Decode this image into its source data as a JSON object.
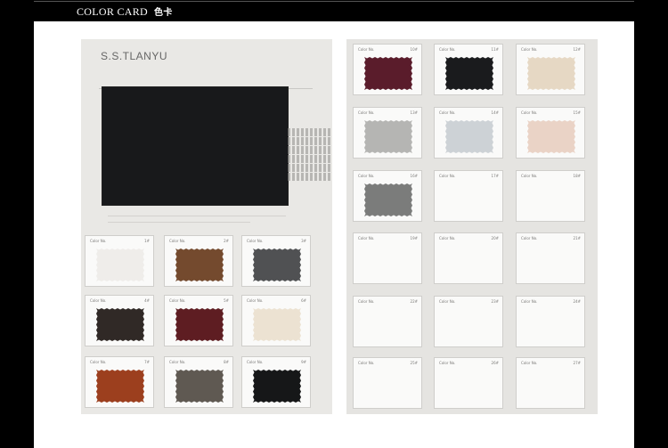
{
  "header": {
    "title_en": "COLOR CARD",
    "title_cn": "色卡"
  },
  "left_page": {
    "brand": "S.S.TLANYU",
    "cards": [
      {
        "label": "Color No.",
        "num": "1#",
        "color": "#efedea"
      },
      {
        "label": "Color No.",
        "num": "2#",
        "color": "#744a2e"
      },
      {
        "label": "Color No.",
        "num": "3#",
        "color": "#505153"
      },
      {
        "label": "Color No.",
        "num": "4#",
        "color": "#302926"
      },
      {
        "label": "Color No.",
        "num": "5#",
        "color": "#5e1d22"
      },
      {
        "label": "Color No.",
        "num": "6#",
        "color": "#ece2d2"
      },
      {
        "label": "Color No.",
        "num": "7#",
        "color": "#9c3f1e"
      },
      {
        "label": "Color No.",
        "num": "8#",
        "color": "#5f5952"
      },
      {
        "label": "Color No.",
        "num": "9#",
        "color": "#161718"
      }
    ]
  },
  "right_page": {
    "cards": [
      {
        "label": "Color No.",
        "num": "10#",
        "color": "#5a1c2b"
      },
      {
        "label": "Color No.",
        "num": "11#",
        "color": "#1a1b1d"
      },
      {
        "label": "Color No.",
        "num": "12#",
        "color": "#e6d8c4"
      },
      {
        "label": "Color No.",
        "num": "13#",
        "color": "#b5b5b3"
      },
      {
        "label": "Color No.",
        "num": "14#",
        "color": "#cdd2d6"
      },
      {
        "label": "Color No.",
        "num": "15#",
        "color": "#ead3c6"
      },
      {
        "label": "Color No.",
        "num": "16#",
        "color": "#7b7c7b"
      },
      {
        "label": "Color No.",
        "num": "17#",
        "color": ""
      },
      {
        "label": "Color No.",
        "num": "18#",
        "color": ""
      },
      {
        "label": "Color No.",
        "num": "19#",
        "color": ""
      },
      {
        "label": "Color No.",
        "num": "20#",
        "color": ""
      },
      {
        "label": "Color No.",
        "num": "21#",
        "color": ""
      },
      {
        "label": "Color No.",
        "num": "22#",
        "color": ""
      },
      {
        "label": "Color No.",
        "num": "23#",
        "color": ""
      },
      {
        "label": "Color No.",
        "num": "24#",
        "color": ""
      },
      {
        "label": "Color No.",
        "num": "25#",
        "color": ""
      },
      {
        "label": "Color No.",
        "num": "26#",
        "color": ""
      },
      {
        "label": "Color No.",
        "num": "27#",
        "color": ""
      }
    ]
  },
  "big_swatch_color": "#18191b"
}
